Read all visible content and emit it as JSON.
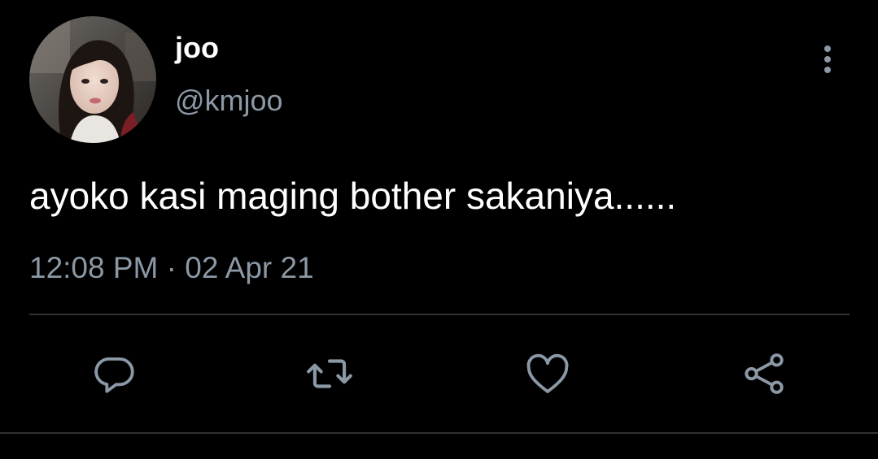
{
  "user": {
    "display_name": "joo",
    "handle": "@kmjoo"
  },
  "tweet": {
    "text": "ayoko kasi maging bother sakaniya......",
    "time": "12:08 PM",
    "separator": "·",
    "date": "02 Apr 21"
  },
  "icons": {
    "more": "more-vertical-icon",
    "reply": "reply-icon",
    "retweet": "retweet-icon",
    "like": "heart-icon",
    "share": "share-icon"
  },
  "colors": {
    "background": "#000000",
    "text": "#ffffff",
    "secondary": "#8b98a5",
    "divider": "#2f3336"
  }
}
